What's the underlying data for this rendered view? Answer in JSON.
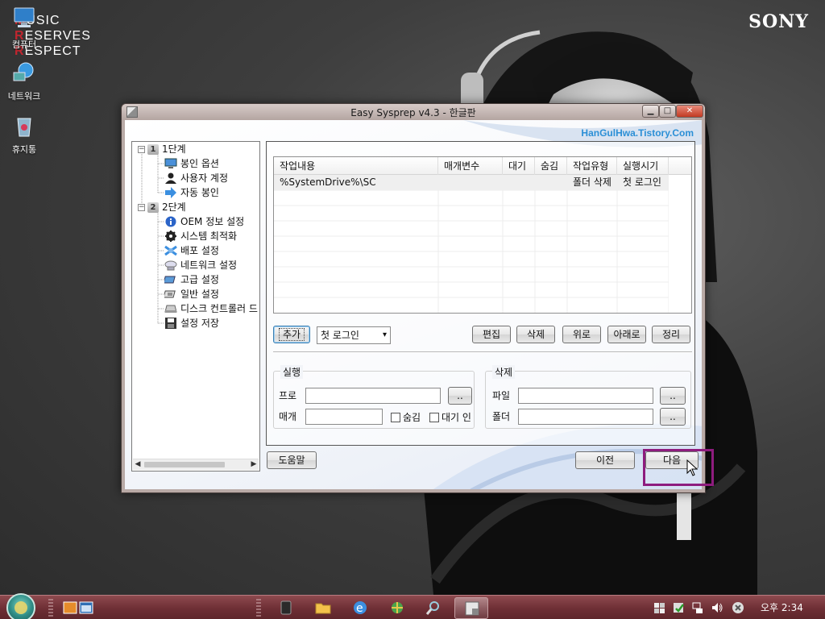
{
  "desktop": {
    "brand": "SONY",
    "logo_lines": [
      {
        "first": "M",
        "rest": "USIC"
      },
      {
        "first": "R",
        "rest": "ESERVES"
      },
      {
        "first": "R",
        "rest": "ESPECT"
      }
    ],
    "icons": [
      {
        "label": "컴퓨터",
        "icon": "computer-icon"
      },
      {
        "label": "네트워크",
        "icon": "network-icon"
      },
      {
        "label": "휴지통",
        "icon": "recycle-bin-icon"
      }
    ]
  },
  "window": {
    "title": "Easy Sysprep v4.3 - 한글판",
    "site_link": "HanGulHwa.Tistory.Com",
    "controls": {
      "minimize": "▁",
      "maximize": "□",
      "close": "✕"
    }
  },
  "tree": {
    "steps": [
      {
        "num": "1",
        "label": "1단계",
        "items": [
          {
            "label": "봉인 옵션",
            "icon": "monitor-icon"
          },
          {
            "label": "사용자 계정",
            "icon": "user-icon"
          },
          {
            "label": "자동 봉인",
            "icon": "arrow-right-icon"
          }
        ]
      },
      {
        "num": "2",
        "label": "2단계",
        "items": [
          {
            "label": "OEM 정보 설정",
            "icon": "info-icon"
          },
          {
            "label": "시스템 최적화",
            "icon": "gear-icon"
          },
          {
            "label": "배포 설정",
            "icon": "deploy-icon"
          },
          {
            "label": "네트워크 설정",
            "icon": "network-icon"
          },
          {
            "label": "고급 설정",
            "icon": "advanced-icon"
          },
          {
            "label": "일반 설정",
            "icon": "general-icon"
          },
          {
            "label": "디스크 컨트롤러 드",
            "icon": "disk-icon"
          },
          {
            "label": "설정 저장",
            "icon": "save-icon"
          }
        ]
      }
    ]
  },
  "tasks": {
    "columns": [
      "작업내용",
      "매개변수",
      "대기",
      "숨김",
      "작업유형",
      "실행시기"
    ],
    "rows": [
      [
        "%SystemDrive%\\SC",
        "",
        "",
        "",
        "폴더 삭제",
        "첫 로그인"
      ]
    ],
    "add_button": "추가",
    "timing_select": "첫 로그인",
    "buttons": {
      "edit": "편집",
      "delete": "삭제",
      "up": "위로",
      "down": "아래로",
      "sort": "정리"
    }
  },
  "run_group": {
    "title": "실행",
    "program_label": "프로",
    "program_value": "",
    "param_label": "매개",
    "param_value": "",
    "browse": "..",
    "hidden_label": "숨김",
    "hidden_checked": false,
    "wait_label": "대기 인",
    "wait_checked": false
  },
  "delete_group": {
    "title": "삭제",
    "file_label": "파일",
    "file_value": "",
    "folder_label": "폴더",
    "folder_value": "",
    "browse": ".."
  },
  "footer": {
    "help": "도움말",
    "prev": "이전",
    "next": "다음"
  },
  "taskbar": {
    "clock": "오후 2:34",
    "pinned": [
      "folder-icon",
      "ie-icon",
      "network-globe-icon",
      "search-tool-icon"
    ],
    "tray": [
      "flag-icon",
      "shield-check-icon",
      "network-icon",
      "speaker-icon",
      "close-circle-icon"
    ]
  }
}
